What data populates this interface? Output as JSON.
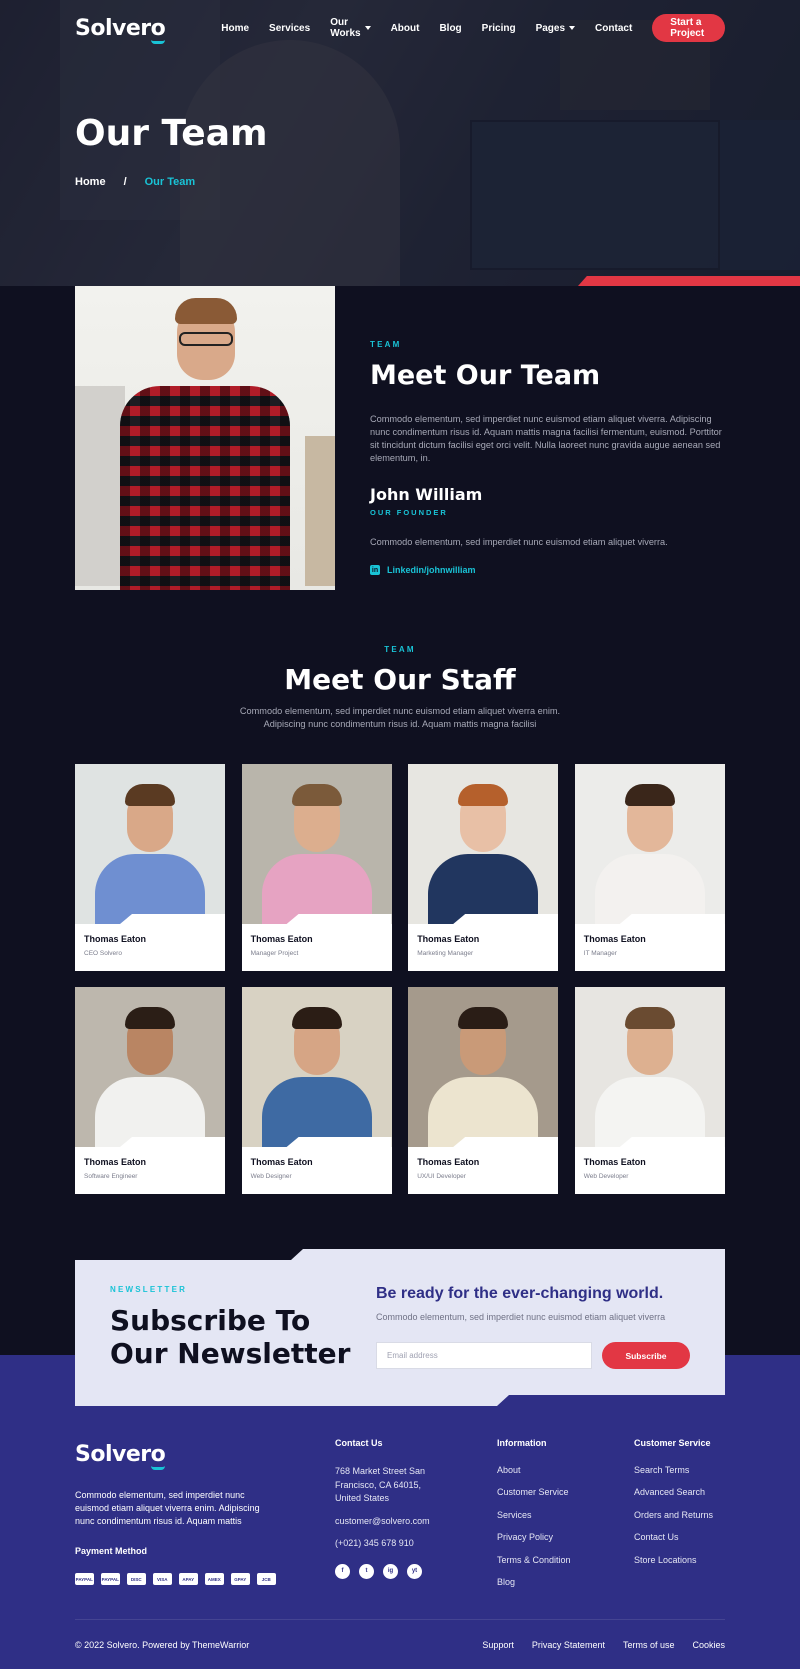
{
  "brand": {
    "name": "Solvero",
    "accent": "#19c3d6",
    "cta_color": "#e23744",
    "footer_color": "#2f2f86"
  },
  "nav": {
    "items": [
      {
        "label": "Home",
        "dropdown": false
      },
      {
        "label": "Services",
        "dropdown": false
      },
      {
        "label": "Our Works",
        "dropdown": true
      },
      {
        "label": "About",
        "dropdown": false
      },
      {
        "label": "Blog",
        "dropdown": false
      },
      {
        "label": "Pricing",
        "dropdown": false
      },
      {
        "label": "Pages",
        "dropdown": true
      },
      {
        "label": "Contact",
        "dropdown": false
      }
    ],
    "cta": "Start a Project"
  },
  "hero": {
    "title": "Our Team",
    "breadcrumb": {
      "home": "Home",
      "separator": "/",
      "current": "Our Team"
    }
  },
  "about": {
    "tag": "TEAM",
    "title": "Meet Our Team",
    "text": "Commodo elementum, sed imperdiet nunc euismod etiam aliquet viverra. Adipiscing nunc condimentum risus id. Aquam mattis magna facilisi fermentum, euismod. Porttitor sit tincidunt dictum facilisi eget orci velit. Nulla laoreet nunc gravida augue aenean sed elementum, in.",
    "person_name": "John William",
    "person_role": "OUR FOUNDER",
    "person_text": "Commodo elementum, sed imperdiet nunc euismod etiam aliquet viverra.",
    "linkedin": "Linkedin/johnwilliam",
    "linkedin_icon": "linkedin-icon"
  },
  "staff": {
    "tag": "TEAM",
    "title": "Meet Our Staff",
    "text_line1": "Commodo elementum, sed imperdiet nunc euismod etiam aliquet viverra enim.",
    "text_line2": "Adipiscing nunc condimentum risus id. Aquam mattis magna facilisi",
    "members": [
      {
        "name": "Thomas Eaton",
        "position": "CEO Solvero"
      },
      {
        "name": "Thomas Eaton",
        "position": "Manager Project"
      },
      {
        "name": "Thomas Eaton",
        "position": "Marketing Manager"
      },
      {
        "name": "Thomas Eaton",
        "position": "IT Manager"
      },
      {
        "name": "Thomas Eaton",
        "position": "Software Engineer"
      },
      {
        "name": "Thomas Eaton",
        "position": "Web Designer"
      },
      {
        "name": "Thomas Eaton",
        "position": "UX/UI Developer"
      },
      {
        "name": "Thomas Eaton",
        "position": "Web Developer"
      }
    ]
  },
  "newsletter": {
    "tag": "NEWSLETTER",
    "title_line1": "Subscribe To",
    "title_line2": "Our Newsletter",
    "heading": "Be ready for the ever-changing world.",
    "text": "Commodo elementum, sed imperdiet nunc euismod etiam aliquet viverra",
    "email_placeholder": "Email address",
    "button": "Subscribe"
  },
  "footer": {
    "about": "Commodo elementum, sed imperdiet nunc euismod etiam aliquet viverra enim. Adipiscing nunc condimentum risus id. Aquam mattis",
    "payment_heading": "Payment Method",
    "payment_methods": [
      "PAYPAL",
      "PAYPAL",
      "DISC",
      "VISA",
      "APAY",
      "AMEX",
      "GPAY",
      "JCB"
    ],
    "contact": {
      "heading": "Contact Us",
      "address": "768 Market Street San Francisco, CA 64015, United States",
      "email": "customer@solvero.com",
      "phone": "(+021) 345 678 910",
      "social": [
        "f",
        "t",
        "ig",
        "yt"
      ]
    },
    "information": {
      "heading": "Information",
      "links": [
        "About",
        "Customer Service",
        "Services",
        "Privacy Policy",
        "Terms & Condition",
        "Blog"
      ]
    },
    "customer_service": {
      "heading": "Customer Service",
      "links": [
        "Search Terms",
        "Advanced Search",
        "Orders and Returns",
        "Contact Us",
        "Store Locations"
      ]
    },
    "copyright": "© 2022 Solvero. Powered by ThemeWarrior",
    "bottom_links": [
      "Support",
      "Privacy Statement",
      "Terms of use",
      "Cookies"
    ]
  }
}
